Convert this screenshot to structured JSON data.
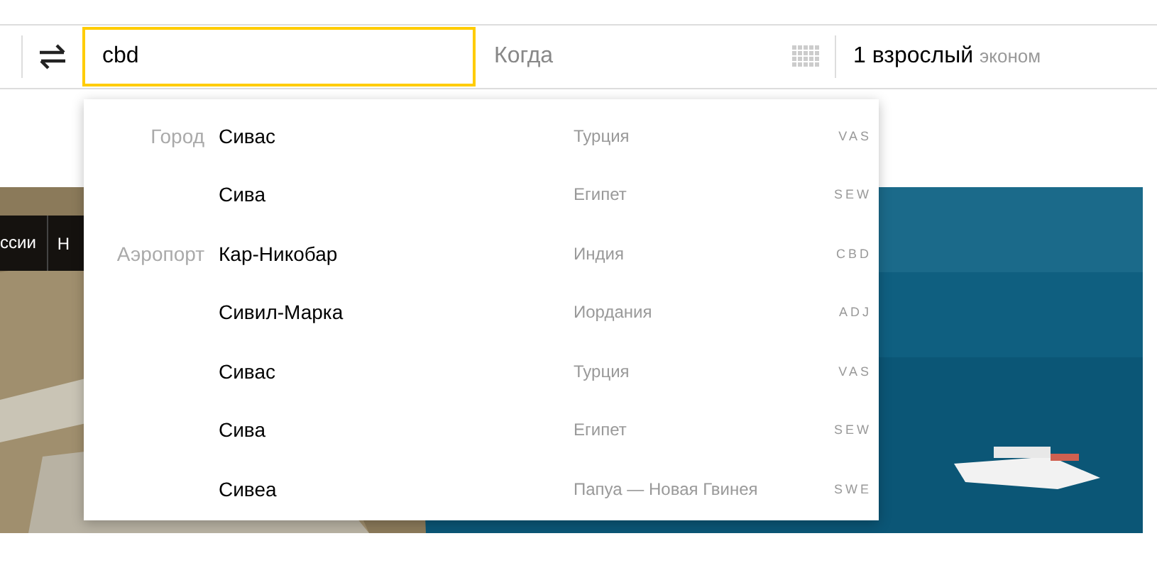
{
  "search": {
    "from_value": "cbd",
    "date_placeholder": "Когда",
    "passengers": "1 взрослый",
    "fare_class": "эконом"
  },
  "nav": [
    "ссии",
    "Н"
  ],
  "suggestions": [
    {
      "label": "Город",
      "items": [
        {
          "name": "Сивас",
          "country": "Турция",
          "code": "VAS"
        },
        {
          "name": "Сива",
          "country": "Египет",
          "code": "SEW"
        }
      ]
    },
    {
      "label": "Аэропорт",
      "items": [
        {
          "name": "Кар-Никобар",
          "country": "Индия",
          "code": "CBD"
        },
        {
          "name": "Сивил-Марка",
          "country": "Иордания",
          "code": "ADJ"
        },
        {
          "name": "Сивас",
          "country": "Турция",
          "code": "VAS"
        },
        {
          "name": "Сива",
          "country": "Египет",
          "code": "SEW"
        },
        {
          "name": "Сивеа",
          "country": "Папуа — Новая Гвинея",
          "code": "SWE"
        }
      ]
    }
  ]
}
